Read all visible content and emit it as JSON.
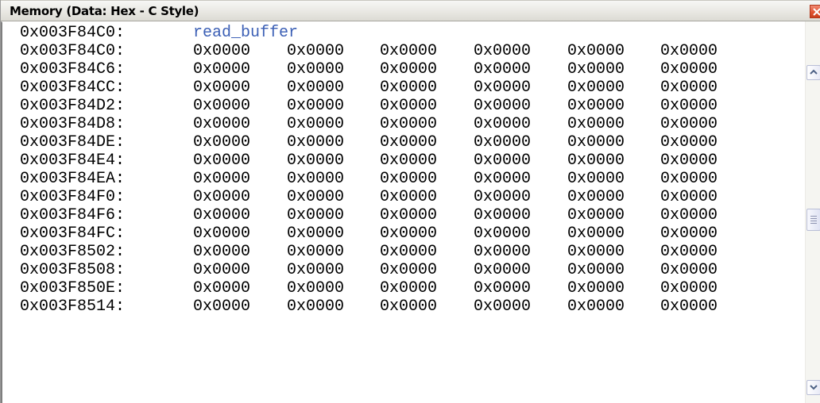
{
  "window": {
    "title": "Memory (Data: Hex - C Style)"
  },
  "memory": {
    "symbol_row": {
      "address": "0x003F84C0:",
      "symbol": "read_buffer"
    },
    "rows": [
      {
        "address": "0x003F84C0:",
        "values": [
          "0x0000",
          "0x0000",
          "0x0000",
          "0x0000",
          "0x0000",
          "0x0000"
        ]
      },
      {
        "address": "0x003F84C6:",
        "values": [
          "0x0000",
          "0x0000",
          "0x0000",
          "0x0000",
          "0x0000",
          "0x0000"
        ]
      },
      {
        "address": "0x003F84CC:",
        "values": [
          "0x0000",
          "0x0000",
          "0x0000",
          "0x0000",
          "0x0000",
          "0x0000"
        ]
      },
      {
        "address": "0x003F84D2:",
        "values": [
          "0x0000",
          "0x0000",
          "0x0000",
          "0x0000",
          "0x0000",
          "0x0000"
        ]
      },
      {
        "address": "0x003F84D8:",
        "values": [
          "0x0000",
          "0x0000",
          "0x0000",
          "0x0000",
          "0x0000",
          "0x0000"
        ]
      },
      {
        "address": "0x003F84DE:",
        "values": [
          "0x0000",
          "0x0000",
          "0x0000",
          "0x0000",
          "0x0000",
          "0x0000"
        ]
      },
      {
        "address": "0x003F84E4:",
        "values": [
          "0x0000",
          "0x0000",
          "0x0000",
          "0x0000",
          "0x0000",
          "0x0000"
        ]
      },
      {
        "address": "0x003F84EA:",
        "values": [
          "0x0000",
          "0x0000",
          "0x0000",
          "0x0000",
          "0x0000",
          "0x0000"
        ]
      },
      {
        "address": "0x003F84F0:",
        "values": [
          "0x0000",
          "0x0000",
          "0x0000",
          "0x0000",
          "0x0000",
          "0x0000"
        ]
      },
      {
        "address": "0x003F84F6:",
        "values": [
          "0x0000",
          "0x0000",
          "0x0000",
          "0x0000",
          "0x0000",
          "0x0000"
        ]
      },
      {
        "address": "0x003F84FC:",
        "values": [
          "0x0000",
          "0x0000",
          "0x0000",
          "0x0000",
          "0x0000",
          "0x0000"
        ]
      },
      {
        "address": "0x003F8502:",
        "values": [
          "0x0000",
          "0x0000",
          "0x0000",
          "0x0000",
          "0x0000",
          "0x0000"
        ]
      },
      {
        "address": "0x003F8508:",
        "values": [
          "0x0000",
          "0x0000",
          "0x0000",
          "0x0000",
          "0x0000",
          "0x0000"
        ]
      },
      {
        "address": "0x003F850E:",
        "values": [
          "0x0000",
          "0x0000",
          "0x0000",
          "0x0000",
          "0x0000",
          "0x0000"
        ]
      },
      {
        "address": "0x003F8514:",
        "values": [
          "0x0000",
          "0x0000",
          "0x0000",
          "0x0000",
          "0x0000",
          "0x0000"
        ]
      }
    ]
  },
  "scrollbar": {
    "up_icon": "chevron-up-icon",
    "down_icon": "chevron-down-icon",
    "thumb_icon": "grip-icon",
    "position": 0.5
  },
  "colors": {
    "symbol_text": "#3b5fb5",
    "close_button": "#e0502d"
  }
}
